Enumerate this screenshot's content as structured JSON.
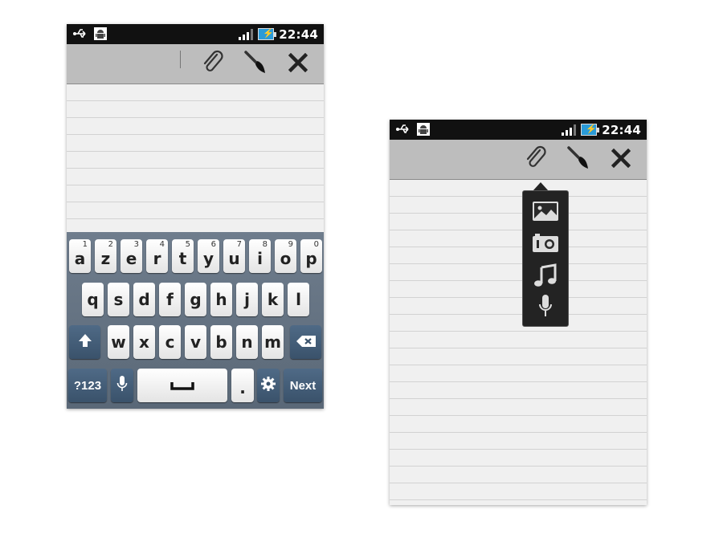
{
  "status_bar": {
    "time": "22:44"
  },
  "keyboard": {
    "row1": [
      {
        "letter": "a",
        "number": "1"
      },
      {
        "letter": "z",
        "number": "2"
      },
      {
        "letter": "e",
        "number": "3"
      },
      {
        "letter": "r",
        "number": "4"
      },
      {
        "letter": "t",
        "number": "5"
      },
      {
        "letter": "y",
        "number": "6"
      },
      {
        "letter": "u",
        "number": "7"
      },
      {
        "letter": "i",
        "number": "8"
      },
      {
        "letter": "o",
        "number": "9"
      },
      {
        "letter": "p",
        "number": "0"
      }
    ],
    "row2": [
      "q",
      "s",
      "d",
      "f",
      "g",
      "h",
      "j",
      "k",
      "l"
    ],
    "row3": [
      "w",
      "x",
      "c",
      "v",
      "b",
      "n",
      "m"
    ],
    "symbols_label": "?123",
    "period_label": ".",
    "next_label": "Next"
  },
  "toolbar_icons": [
    "paperclip-icon",
    "brush-icon",
    "close-icon"
  ],
  "attach_menu_icons": [
    "image-icon",
    "camera-icon",
    "music-icon",
    "microphone-icon"
  ]
}
